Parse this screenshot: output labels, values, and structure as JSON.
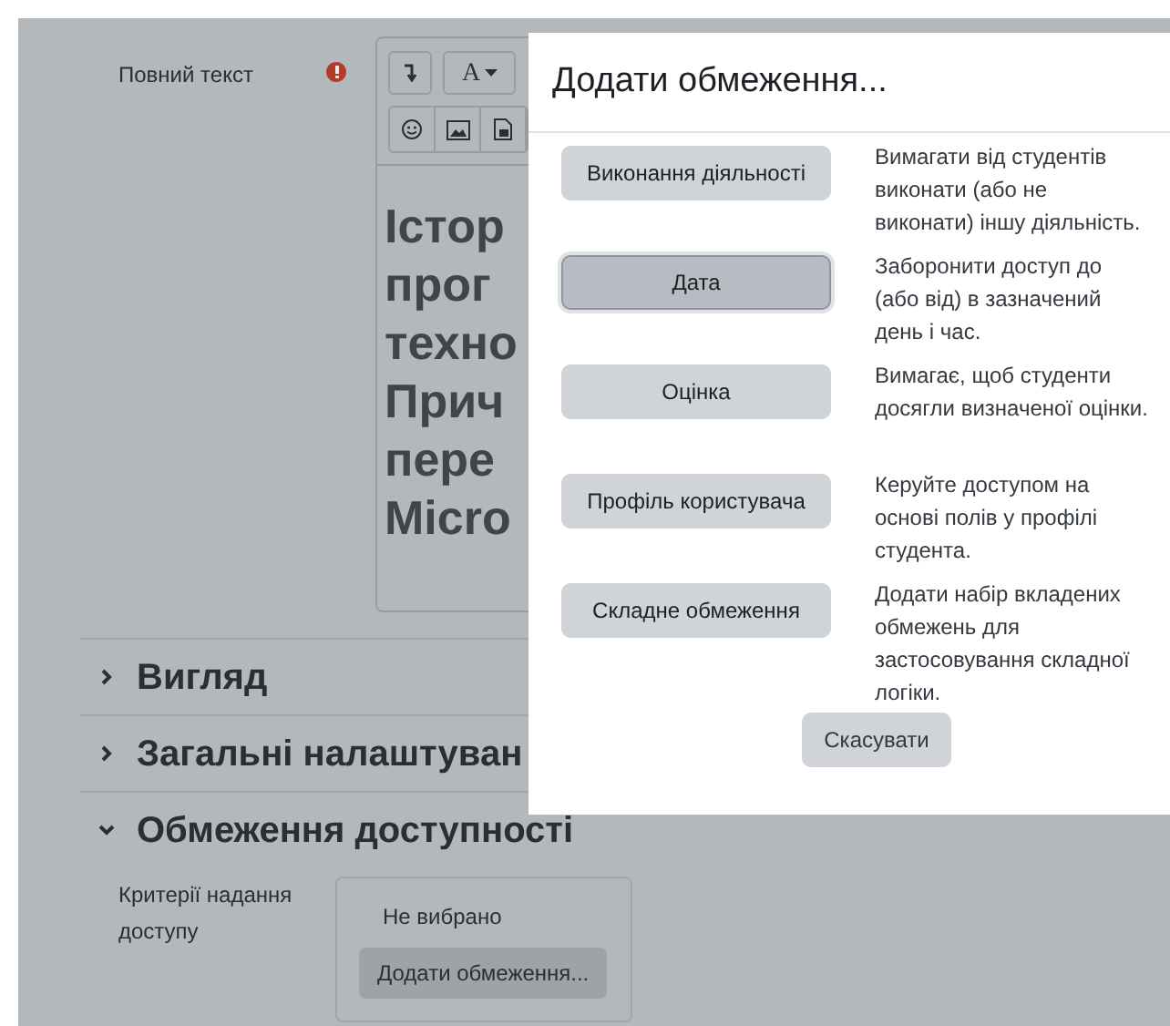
{
  "form": {
    "field_label": "Повний текст",
    "required": true,
    "toolbar": [
      {
        "kind": "indent"
      },
      {
        "kind": "font",
        "label": "A"
      },
      {
        "kind": "emoji"
      },
      {
        "kind": "image"
      },
      {
        "kind": "media"
      }
    ],
    "editor_lines": [
      "Істор",
      "прог",
      "техно",
      "Прич",
      "пере",
      "Micro"
    ]
  },
  "sections": [
    {
      "title": "Вигляд",
      "expanded": false
    },
    {
      "title": "Загальні налаштуван",
      "expanded": false
    },
    {
      "title": "Обмеження доступності",
      "expanded": true
    }
  ],
  "restrictions": {
    "label": "Критерії надання доступу",
    "status": "Не вибрано",
    "add_button": "Додати обмеження..."
  },
  "dialog": {
    "title": "Додати обмеження...",
    "options": [
      {
        "label": "Виконання діяльності",
        "description": "Вимагати від студентів виконати (або не виконати) іншу діяльність.",
        "focused": false
      },
      {
        "label": "Дата",
        "description": "Заборонити доступ до (або від) в зазначений день і час.",
        "focused": true
      },
      {
        "label": "Оцінка",
        "description": "Вимагає, щоб студенти досягли визначеної оцінки.",
        "focused": false
      },
      {
        "label": "Профіль користувача",
        "description": "Керуйте доступом на основі полів у профілі студента.",
        "focused": false
      },
      {
        "label": "Складне обмеження",
        "description": "Додати набір вкладених обмежень для застосовування складної логіки.",
        "focused": false
      }
    ],
    "cancel": "Скасувати"
  }
}
